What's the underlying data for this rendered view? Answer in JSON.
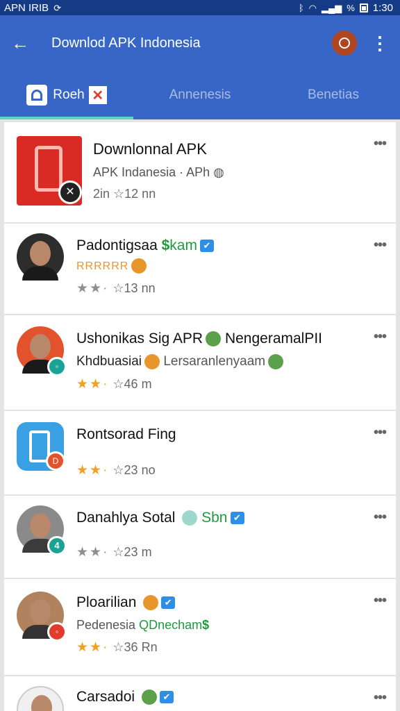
{
  "status_bar": {
    "carrier": "APN IRIB",
    "time": "1:30",
    "percent_sign": "%"
  },
  "app_bar": {
    "title": "Downlod APK Indonesia"
  },
  "tabs": [
    {
      "label": "Roeh",
      "active": true
    },
    {
      "label": "Annenesis",
      "active": false
    },
    {
      "label": "Benetias",
      "active": false
    }
  ],
  "items": [
    {
      "title": "Downlonnal APK",
      "subtitle": "APK Indanesia · APh",
      "meta": "2in ☆12 nn"
    },
    {
      "title": "Padontigsaa",
      "title_extra": "kam",
      "subtitle": "RRRRRR",
      "stars": "★★·",
      "meta": "☆13 nn"
    },
    {
      "title": "Ushonikas Sig APR",
      "title_extra": "NengeramalPII",
      "subtitle": "Khdbuasiai",
      "subtitle_extra": "Lersaranlenyaam",
      "stars": "★★·",
      "meta": "☆46 m"
    },
    {
      "title": "Rontsorad Fing",
      "stars": "★★·",
      "meta": "☆23 no"
    },
    {
      "title": "Danahlya Sotal",
      "title_extra": "Sbn",
      "stars": "★★·",
      "meta": "☆23 m"
    },
    {
      "title": "Ploarilian",
      "subtitle": "Pedenesia",
      "subtitle_extra": "QDnecham",
      "stars": "★★·",
      "meta": "☆36 Rn"
    },
    {
      "title": "Carsadoi"
    }
  ]
}
